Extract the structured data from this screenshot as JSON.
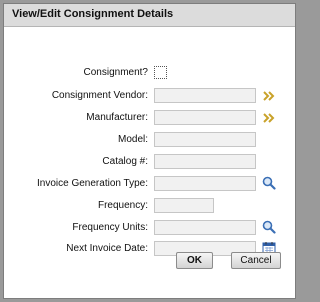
{
  "dialog": {
    "title": "View/Edit Consignment Details"
  },
  "form": {
    "consignment_label": "Consignment?",
    "consignment_checked": false,
    "vendor_label": "Consignment Vendor:",
    "vendor_value": "",
    "manufacturer_label": "Manufacturer:",
    "manufacturer_value": "",
    "model_label": "Model:",
    "model_value": "",
    "catalog_label": "Catalog #:",
    "catalog_value": "",
    "invoice_gen_label": "Invoice Generation Type:",
    "invoice_gen_value": "",
    "frequency_label": "Frequency:",
    "frequency_value": "",
    "frequency_units_label": "Frequency Units:",
    "frequency_units_value": "",
    "next_invoice_label": "Next Invoice Date:",
    "next_invoice_value": ""
  },
  "icons": {
    "vendor_picker": "double-chevron-right-icon",
    "manufacturer_picker": "double-chevron-right-icon",
    "invoice_gen_lookup": "magnifier-icon",
    "frequency_units_lookup": "magnifier-icon",
    "next_invoice_calendar": "calendar-icon"
  },
  "buttons": {
    "ok_label": "OK",
    "cancel_label": "Cancel"
  },
  "colors": {
    "titlebar": "#dcdcdc",
    "field_bg": "#f1f1f1",
    "chevron": "#c9a22a",
    "magnifier": "#3b6fb5",
    "calendar": "#2f5fa8"
  }
}
